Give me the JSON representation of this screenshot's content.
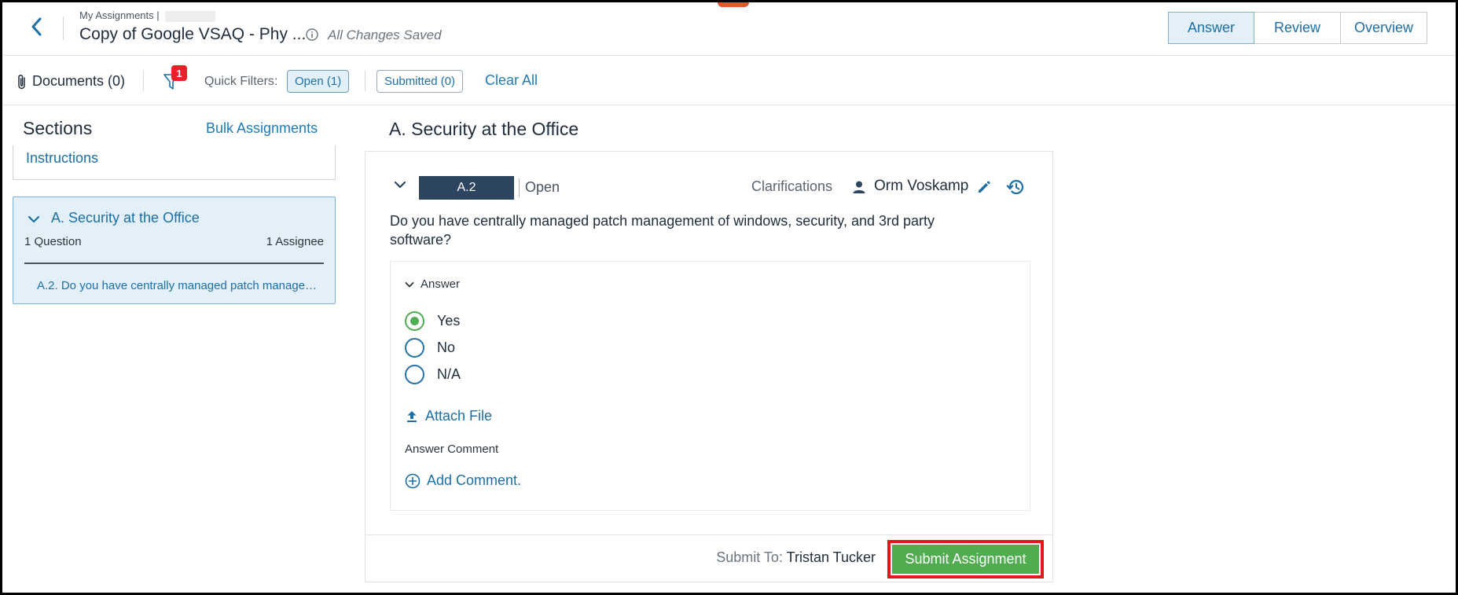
{
  "header": {
    "breadcrumb": "My Assignments |",
    "title": "Copy of Google VSAQ - Phy ...",
    "saved_status": "All Changes Saved",
    "tabs": [
      {
        "label": "Answer",
        "active": true
      },
      {
        "label": "Review",
        "active": false
      },
      {
        "label": "Overview",
        "active": false
      }
    ]
  },
  "toolbar": {
    "documents_label": "Documents (0)",
    "filter_badge": "1",
    "quick_filters_label": "Quick Filters:",
    "chip_open": "Open (1)",
    "chip_submitted": "Submitted (0)",
    "clear_all": "Clear All"
  },
  "sidebar": {
    "title": "Sections",
    "bulk_link": "Bulk Assignments",
    "instructions": "Instructions",
    "section": {
      "title": "A. Security at the Office",
      "question_count": "1 Question",
      "assignee_count": "1 Assignee",
      "question_link": "A.2. Do you have centrally managed patch management of windows, security, and 3rd party software?"
    }
  },
  "main": {
    "title": "A. Security at the Office",
    "question": {
      "id": "A.2",
      "status": "Open",
      "clarifications": "Clarifications",
      "assignee": "Orm Voskamp",
      "text": "Do you have centrally managed patch management of windows, security, and 3rd party software?",
      "answer_label": "Answer",
      "options": [
        "Yes",
        "No",
        "N/A"
      ],
      "selected": "Yes",
      "attach_file": "Attach File",
      "comment_label": "Answer Comment",
      "add_comment": "Add Comment."
    },
    "footer": {
      "submit_to_label": "Submit To:",
      "submit_to_name": "Tristan Tucker",
      "submit_button": "Submit Assignment"
    }
  },
  "colors": {
    "accent": "#1d6fa5",
    "selected_bg": "#e3f0fa",
    "success": "#4fad4f",
    "badge": "#e8212a",
    "highlight_border": "#e01a1a"
  }
}
